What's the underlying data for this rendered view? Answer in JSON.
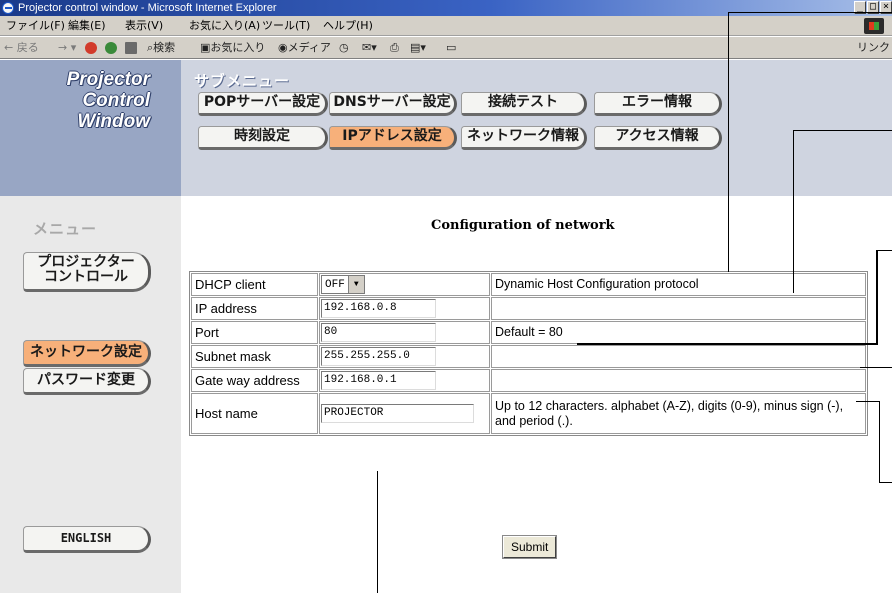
{
  "window": {
    "title": "Projector control window - Microsoft Internet Explorer",
    "controls": [
      "_",
      "□",
      "×"
    ]
  },
  "menubar": {
    "items": [
      "ファイル(F)",
      "編集(E)",
      "表示(V)",
      "お気に入り(A)",
      "ツール(T)",
      "ヘルプ(H)"
    ]
  },
  "toolbar": {
    "back": "← 戻る",
    "search": "検索",
    "favorites": "お気に入り",
    "media": "メディア",
    "links": "リンク"
  },
  "logo": {
    "line1": "Projector",
    "line2": "Control",
    "line3": "Window"
  },
  "submenu": {
    "title": "サブメニュー",
    "buttons": {
      "pop": "POPサーバー設定",
      "dns": "DNSサーバー設定",
      "connect_test": "接続テスト",
      "error_info": "エラー情報",
      "time": "時刻設定",
      "ip": "IPアドレス設定",
      "network_info": "ネットワーク情報",
      "access_info": "アクセス情報"
    },
    "active": "ip"
  },
  "menu": {
    "title": "メニュー",
    "projector_control_line1": "プロジェクター",
    "projector_control_line2": "コントロール",
    "network_settings": "ネットワーク設定",
    "password_change": "パスワード変更",
    "english": "ENGLISH"
  },
  "content": {
    "title": "Configuration of network",
    "rows": {
      "dhcp": {
        "label": "DHCP client",
        "value": "OFF",
        "desc": "Dynamic Host Configuration protocol"
      },
      "ip": {
        "label": "IP address",
        "value": "192.168.0.8",
        "desc": ""
      },
      "port": {
        "label": "Port",
        "value": "80",
        "desc": "Default = 80"
      },
      "subnet": {
        "label": "Subnet mask",
        "value": "255.255.255.0",
        "desc": ""
      },
      "gateway": {
        "label": "Gate way address",
        "value": "192.168.0.1",
        "desc": ""
      },
      "host": {
        "label": "Host name",
        "value": "PROJECTOR",
        "desc": "Up to 12 characters. alphabet (A-Z), digits (0-9), minus sign (-), and period (.)."
      }
    },
    "submit_label": "Submit"
  },
  "colors": {
    "logo_panel": "#98a6c4",
    "submenu_panel": "#cfd4e0",
    "left_panel": "#e9e9e9",
    "active_button": "#f7b07a",
    "button": "#f4f4f2"
  }
}
